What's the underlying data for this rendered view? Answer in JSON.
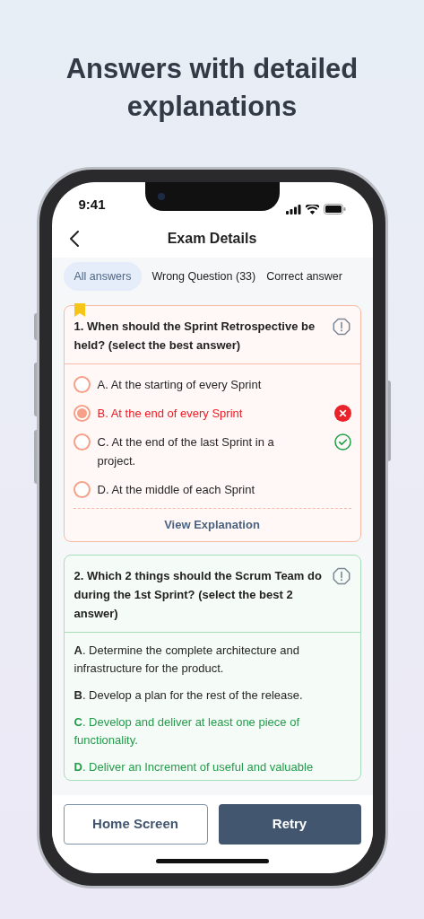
{
  "headline": "Answers with detailed explanations",
  "status_bar": {
    "time": "9:41"
  },
  "header": {
    "title": "Exam Details"
  },
  "tabs": [
    {
      "label": "All answers",
      "selected": true
    },
    {
      "label": "Wrong Question (33)",
      "selected": false
    },
    {
      "label": "Correct answer",
      "selected": false
    }
  ],
  "questions": [
    {
      "kind": "radio",
      "wrong": true,
      "bookmarked": true,
      "text": "1. When should the Sprint Retrospective be held? (select the best answer)",
      "action": "View Explanation",
      "options": [
        {
          "text": "A. At the starting of every Sprint",
          "selected": false,
          "wrong": false,
          "correct": false
        },
        {
          "text": "B. At the end of every Sprint",
          "selected": true,
          "wrong": true,
          "correct": false
        },
        {
          "text": "C. At the end of the last Sprint in a project.",
          "selected": false,
          "wrong": false,
          "correct": true
        },
        {
          "text": "D. At the middle of each Sprint",
          "selected": false,
          "wrong": false,
          "correct": false
        }
      ]
    },
    {
      "kind": "plain",
      "wrong": false,
      "bookmarked": false,
      "text": "2. Which 2 things should the Scrum Team do during the 1st Sprint? (select the best 2 answer)",
      "options": [
        {
          "text": "**A**. Determine the complete architecture and infrastructure for the product.",
          "correct": false
        },
        {
          "text": "**B**. Develop a plan for the rest of the release.",
          "correct": false
        },
        {
          "text": "**C**. Develop and deliver at least one piece of functionality.",
          "correct": true
        },
        {
          "text": "**D**. Deliver an Increment of useful and valuable",
          "correct": true
        }
      ]
    }
  ],
  "buttons": [
    {
      "label": "Home Screen",
      "kind": "outline"
    },
    {
      "label": "Retry",
      "kind": "filled"
    }
  ]
}
